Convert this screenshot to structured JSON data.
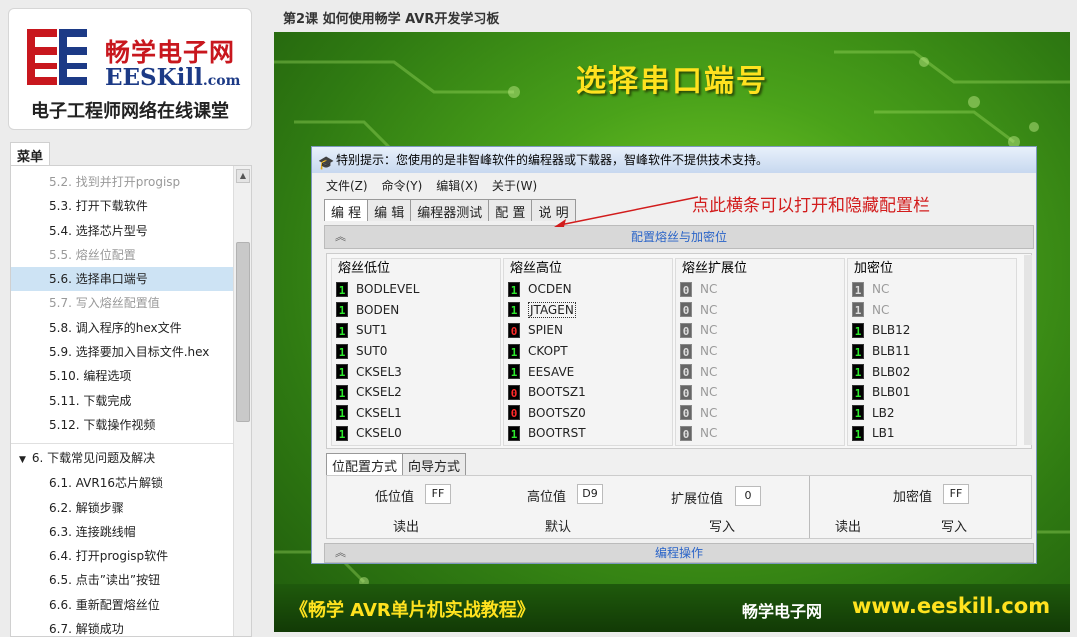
{
  "course_title": "第2课  如何使用畅学 AVR开发学习板",
  "logo": {
    "cn": "畅学电子网",
    "en": "EESKill",
    "en_suffix": ".com",
    "subtitle": "电子工程师网络在线课堂"
  },
  "menu_tab": "菜单",
  "menu_items": [
    {
      "label": "5.2. 找到并打开progisp",
      "state": "dim"
    },
    {
      "label": "5.3. 打开下载软件",
      "state": "normal"
    },
    {
      "label": "5.4. 选择芯片型号",
      "state": "normal"
    },
    {
      "label": "5.5. 熔丝位配置",
      "state": "dim"
    },
    {
      "label": "5.6. 选择串口端号",
      "state": "active"
    },
    {
      "label": "5.7. 写入熔丝配置值",
      "state": "dim"
    },
    {
      "label": "5.8. 调入程序的hex文件",
      "state": "normal"
    },
    {
      "label": "5.9. 选择要加入目标文件.hex",
      "state": "normal"
    },
    {
      "label": "5.10. 编程选项",
      "state": "normal"
    },
    {
      "label": "5.11. 下载完成",
      "state": "normal"
    },
    {
      "label": "5.12. 下载操作视频",
      "state": "normal"
    },
    {
      "label": "6. 下载常见问题及解决",
      "state": "section"
    },
    {
      "label": "6.1. AVR16芯片解锁",
      "state": "normal"
    },
    {
      "label": "6.2. 解锁步骤",
      "state": "normal"
    },
    {
      "label": "6.3. 连接跳线帽",
      "state": "normal"
    },
    {
      "label": "6.4. 打开progisp软件",
      "state": "normal"
    },
    {
      "label": "6.5. 点击”读出”按钮",
      "state": "normal"
    },
    {
      "label": "6.6. 重新配置熔丝位",
      "state": "normal"
    },
    {
      "label": "6.7. 解锁成功",
      "state": "normal"
    }
  ],
  "slide": {
    "title": "选择串口端号",
    "footer_left": "《畅学 AVR单片机实战教程》",
    "footer_brand": "畅学电子网",
    "footer_url": "www.eeskill.com",
    "annotation": "点此横条可以打开和隐藏配置栏"
  },
  "window": {
    "title": "特别提示：您使用的是非智峰软件的编程器或下载器，智峰软件不提供技术支持。",
    "menu": [
      "文件(Z)",
      "命令(Y)",
      "编辑(X)",
      "关于(W)"
    ],
    "tabs": [
      "编 程",
      "编 辑",
      "编程器测试",
      "配 置",
      "说 明"
    ],
    "config_bar": "配置熔丝与加密位",
    "op_bar": "编程操作",
    "mode_tabs": [
      "位配置方式",
      "向导方式"
    ],
    "columns": [
      {
        "title": "熔丝低位",
        "rows": [
          {
            "bit": "1",
            "kind": "b1",
            "name": "BODLEVEL"
          },
          {
            "bit": "1",
            "kind": "b1",
            "name": "BODEN"
          },
          {
            "bit": "1",
            "kind": "b1",
            "name": "SUT1"
          },
          {
            "bit": "1",
            "kind": "b1",
            "name": "SUT0"
          },
          {
            "bit": "1",
            "kind": "b1",
            "name": "CKSEL3"
          },
          {
            "bit": "1",
            "kind": "b1",
            "name": "CKSEL2"
          },
          {
            "bit": "1",
            "kind": "b1",
            "name": "CKSEL1"
          },
          {
            "bit": "1",
            "kind": "b1",
            "name": "CKSEL0"
          }
        ]
      },
      {
        "title": "熔丝高位",
        "rows": [
          {
            "bit": "1",
            "kind": "b1",
            "name": "OCDEN"
          },
          {
            "bit": "1",
            "kind": "b1",
            "name": "JTAGEN"
          },
          {
            "bit": "0",
            "kind": "b0",
            "name": "SPIEN"
          },
          {
            "bit": "1",
            "kind": "b1",
            "name": "CKOPT"
          },
          {
            "bit": "1",
            "kind": "b1",
            "name": "EESAVE"
          },
          {
            "bit": "0",
            "kind": "b0",
            "name": "BOOTSZ1"
          },
          {
            "bit": "0",
            "kind": "b0",
            "name": "BOOTSZ0"
          },
          {
            "bit": "1",
            "kind": "b1",
            "name": "BOOTRST"
          }
        ]
      },
      {
        "title": "熔丝扩展位",
        "rows": [
          {
            "bit": "0",
            "kind": "bg",
            "name": "NC"
          },
          {
            "bit": "0",
            "kind": "bg",
            "name": "NC"
          },
          {
            "bit": "0",
            "kind": "bg",
            "name": "NC"
          },
          {
            "bit": "0",
            "kind": "bg",
            "name": "NC"
          },
          {
            "bit": "0",
            "kind": "bg",
            "name": "NC"
          },
          {
            "bit": "0",
            "kind": "bg",
            "name": "NC"
          },
          {
            "bit": "0",
            "kind": "bg",
            "name": "NC"
          },
          {
            "bit": "0",
            "kind": "bg",
            "name": "NC"
          }
        ]
      },
      {
        "title": "加密位",
        "rows": [
          {
            "bit": "1",
            "kind": "bg",
            "name": "NC"
          },
          {
            "bit": "1",
            "kind": "bg",
            "name": "NC"
          },
          {
            "bit": "1",
            "kind": "b1",
            "name": "BLB12"
          },
          {
            "bit": "1",
            "kind": "b1",
            "name": "BLB11"
          },
          {
            "bit": "1",
            "kind": "b1",
            "name": "BLB02"
          },
          {
            "bit": "1",
            "kind": "b1",
            "name": "BLB01"
          },
          {
            "bit": "1",
            "kind": "b1",
            "name": "LB2"
          },
          {
            "bit": "1",
            "kind": "b1",
            "name": "LB1"
          }
        ]
      }
    ],
    "values": {
      "low_label": "低位值",
      "low": "FF",
      "high_label": "高位值",
      "high": "D9",
      "ext_label": "扩展位值",
      "ext": "0",
      "lock_label": "加密值",
      "lock": "FF",
      "read": "读出",
      "default": "默认",
      "write": "写入",
      "lock_read": "读出",
      "lock_write": "写入"
    }
  },
  "colors": {
    "slide_green": "#4aa21a",
    "title_yellow": "#ffe21f",
    "annotation_red": "#d21c1c",
    "active_item": "#cde3f4"
  }
}
